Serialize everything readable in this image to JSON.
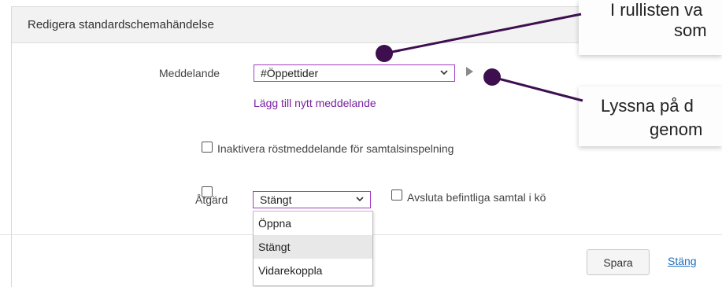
{
  "dialog": {
    "title": "Redigera standardschemahändelse"
  },
  "message": {
    "label": "Meddelande",
    "selected": "#Öppettider",
    "add_link": "Lägg till nytt meddelande"
  },
  "disable_voice": {
    "label": "Inaktivera röstmeddelande för samtalsinspelning",
    "checked": false
  },
  "action": {
    "label": "Åtgärd",
    "selected": "Stängt",
    "options": [
      "Öppna",
      "Stängt",
      "Vidarekoppla"
    ],
    "end_calls_label": "Avsluta befintliga samtal i kö",
    "end_calls_checked": false
  },
  "footer": {
    "save_label": "Spara",
    "close_label": "Stäng"
  },
  "callouts": {
    "top_line1": "I rullisten va",
    "top_line2": "som",
    "bottom_line1": "Lyssna på d",
    "bottom_line2": "genom"
  },
  "colors": {
    "accent_border": "#a23cc7",
    "link_purple": "#7a1fa2",
    "link_blue": "#1f6fbf",
    "marker": "#3d0f4f"
  }
}
